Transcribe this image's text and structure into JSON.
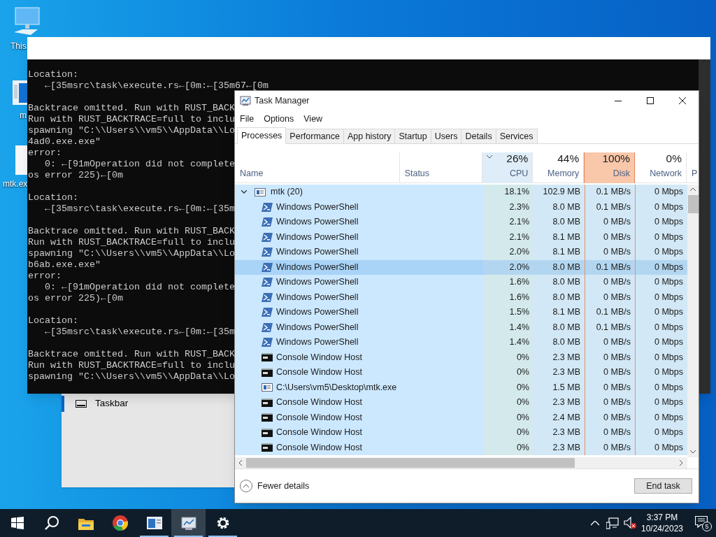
{
  "desktop_icons": [
    {
      "kind": "computer",
      "label": "This"
    },
    {
      "kind": "window",
      "label": "m"
    },
    {
      "kind": "file",
      "label": "mtk.ex"
    }
  ],
  "settings_window": {
    "items": [
      {
        "label": "Taskbar",
        "selected": true
      }
    ]
  },
  "console": {
    "blocks": [
      [
        "Location:",
        "   ←[35msrc\\task\\execute.rs←[0m:←[35m67←[0m"
      ],
      [
        "Backtrace omitted. Run with RUST_BACK",
        "Run with RUST_BACKTRACE=full to inclu",
        "spawning \"C:\\\\Users\\\\vm5\\\\AppData\\\\Lo",
        "4ad0.exe.exe\"",
        "error:",
        "   0: ←[91mOperation did not complete",
        "os error 225)←[0m"
      ],
      [
        "Location:",
        "   ←[35msrc\\task\\execute.rs←[0m:←[35m"
      ],
      [
        "Backtrace omitted. Run with RUST_BACK",
        "Run with RUST_BACKTRACE=full to inclu",
        "spawning \"C:\\\\Users\\\\vm5\\\\AppData\\\\Lo",
        "b6ab.exe.exe\"",
        "error:",
        "   0: ←[91mOperation did not complete",
        "os error 225)←[0m"
      ],
      [
        "Location:",
        "   ←[35msrc\\task\\execute.rs←[0m:←[35m"
      ],
      [
        "Backtrace omitted. Run with RUST_BACK",
        "Run with RUST_BACKTRACE=full to inclu",
        "spawning \"C:\\\\Users\\\\vm5\\\\AppData\\\\Lo"
      ]
    ]
  },
  "task_manager": {
    "title": "Task Manager",
    "menu": [
      "File",
      "Options",
      "View"
    ],
    "tabs": [
      {
        "label": "Processes",
        "selected": true
      },
      {
        "label": "Performance",
        "selected": false
      },
      {
        "label": "App history",
        "selected": false
      },
      {
        "label": "Startup",
        "selected": false
      },
      {
        "label": "Users",
        "selected": false
      },
      {
        "label": "Details",
        "selected": false
      },
      {
        "label": "Services",
        "selected": false
      }
    ],
    "columns": [
      {
        "label": "Name"
      },
      {
        "label": "Status"
      },
      {
        "label": "CPU",
        "percent": "26%",
        "sorted": true,
        "hot": false
      },
      {
        "label": "Memory",
        "percent": "44%",
        "sorted": false,
        "hot": false
      },
      {
        "label": "Disk",
        "percent": "100%",
        "sorted": false,
        "hot": true
      },
      {
        "label": "Network",
        "percent": "0%",
        "sorted": false,
        "hot": false
      },
      {
        "label": "P"
      }
    ],
    "group": {
      "name": "mtk (20)",
      "expanded": true,
      "cpu": "18.1%",
      "memory": "102.9 MB",
      "disk": "0.1 MB/s",
      "network": "0 Mbps",
      "children": [
        {
          "kind": "powershell",
          "name": "Windows PowerShell",
          "cpu": "2.3%",
          "memory": "8.0 MB",
          "disk": "0.1 MB/s",
          "network": "0 Mbps",
          "hovered": false
        },
        {
          "kind": "powershell",
          "name": "Windows PowerShell",
          "cpu": "2.1%",
          "memory": "8.0 MB",
          "disk": "0 MB/s",
          "network": "0 Mbps",
          "hovered": false
        },
        {
          "kind": "powershell",
          "name": "Windows PowerShell",
          "cpu": "2.1%",
          "memory": "8.1 MB",
          "disk": "0 MB/s",
          "network": "0 Mbps",
          "hovered": false
        },
        {
          "kind": "powershell",
          "name": "Windows PowerShell",
          "cpu": "2.0%",
          "memory": "8.1 MB",
          "disk": "0 MB/s",
          "network": "0 Mbps",
          "hovered": false
        },
        {
          "kind": "powershell",
          "name": "Windows PowerShell",
          "cpu": "2.0%",
          "memory": "8.0 MB",
          "disk": "0.1 MB/s",
          "network": "0 Mbps",
          "hovered": true
        },
        {
          "kind": "powershell",
          "name": "Windows PowerShell",
          "cpu": "1.6%",
          "memory": "8.0 MB",
          "disk": "0 MB/s",
          "network": "0 Mbps",
          "hovered": false
        },
        {
          "kind": "powershell",
          "name": "Windows PowerShell",
          "cpu": "1.6%",
          "memory": "8.0 MB",
          "disk": "0 MB/s",
          "network": "0 Mbps",
          "hovered": false
        },
        {
          "kind": "powershell",
          "name": "Windows PowerShell",
          "cpu": "1.5%",
          "memory": "8.1 MB",
          "disk": "0.1 MB/s",
          "network": "0 Mbps",
          "hovered": false
        },
        {
          "kind": "powershell",
          "name": "Windows PowerShell",
          "cpu": "1.4%",
          "memory": "8.0 MB",
          "disk": "0.1 MB/s",
          "network": "0 Mbps",
          "hovered": false
        },
        {
          "kind": "powershell",
          "name": "Windows PowerShell",
          "cpu": "1.4%",
          "memory": "8.0 MB",
          "disk": "0 MB/s",
          "network": "0 Mbps",
          "hovered": false
        },
        {
          "kind": "console",
          "name": "Console Window Host",
          "cpu": "0%",
          "memory": "2.3 MB",
          "disk": "0 MB/s",
          "network": "0 Mbps",
          "hovered": false
        },
        {
          "kind": "console",
          "name": "Console Window Host",
          "cpu": "0%",
          "memory": "2.3 MB",
          "disk": "0 MB/s",
          "network": "0 Mbps",
          "hovered": false
        },
        {
          "kind": "app",
          "name": "C:\\Users\\vm5\\Desktop\\mtk.exe",
          "cpu": "0%",
          "memory": "1.5 MB",
          "disk": "0 MB/s",
          "network": "0 Mbps",
          "hovered": false
        },
        {
          "kind": "console",
          "name": "Console Window Host",
          "cpu": "0%",
          "memory": "2.3 MB",
          "disk": "0 MB/s",
          "network": "0 Mbps",
          "hovered": false
        },
        {
          "kind": "console",
          "name": "Console Window Host",
          "cpu": "0%",
          "memory": "2.4 MB",
          "disk": "0 MB/s",
          "network": "0 Mbps",
          "hovered": false
        },
        {
          "kind": "console",
          "name": "Console Window Host",
          "cpu": "0%",
          "memory": "2.3 MB",
          "disk": "0 MB/s",
          "network": "0 Mbps",
          "hovered": false
        },
        {
          "kind": "console",
          "name": "Console Window Host",
          "cpu": "0%",
          "memory": "2.3 MB",
          "disk": "0 MB/s",
          "network": "0 Mbps",
          "hovered": false
        }
      ]
    },
    "footer": {
      "toggle": "Fewer details",
      "button": "End task"
    }
  },
  "taskbar": {
    "apps": [
      {
        "kind": "start",
        "open": false,
        "active": false
      },
      {
        "kind": "search",
        "open": false,
        "active": false
      },
      {
        "kind": "explorer",
        "open": false,
        "active": false
      },
      {
        "kind": "chrome",
        "open": false,
        "active": false
      },
      {
        "kind": "window",
        "open": true,
        "active": false
      },
      {
        "kind": "taskmanager",
        "open": true,
        "active": true
      },
      {
        "kind": "settings",
        "open": true,
        "active": false
      }
    ],
    "time": "3:37 PM",
    "date": "10/24/2023",
    "notifications": "5"
  }
}
